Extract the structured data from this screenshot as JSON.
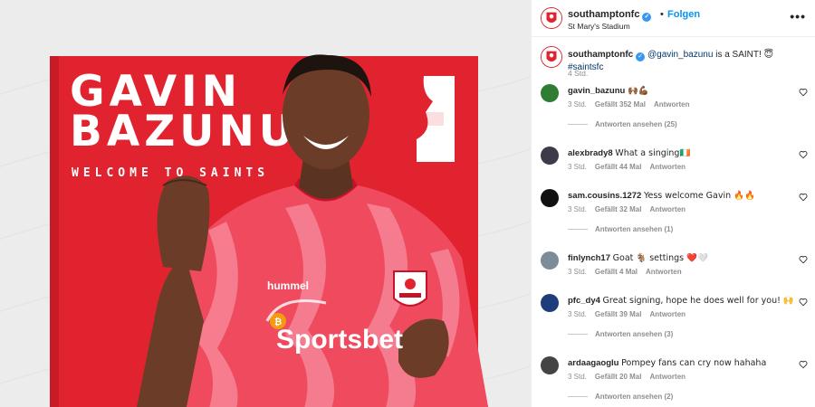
{
  "post": {
    "image": {
      "player_name_line1": "GAVIN",
      "player_name_line2": "BAZUNU",
      "tagline": "WELCOME TO SAINTS",
      "kit_brand": "hummel",
      "sponsor": "Sportsbet"
    }
  },
  "header": {
    "username": "southamptonfc",
    "verified": true,
    "separator": "•",
    "follow_label": "Folgen",
    "location": "St Mary's Stadium",
    "more_label": "•••"
  },
  "caption": {
    "username": "southamptonfc",
    "mention": "@gavin_bazunu",
    "text": " is a SAINT! ",
    "emoji": "😇",
    "hashtag": "#saintsfc",
    "time": "4 Std."
  },
  "comments": [
    {
      "username": "gavin_bazunu",
      "text": "🙌🏾💪🏾",
      "time": "3 Std.",
      "likes": "Gefällt 352 Mal",
      "reply": "Antworten",
      "view_replies": "Antworten ansehen (25)",
      "avatar_color": "#2e7d32"
    },
    {
      "username": "alexbrady8",
      "text": "What a singing🇮🇪",
      "time": "3 Std.",
      "likes": "Gefällt 44 Mal",
      "reply": "Antworten",
      "view_replies": "",
      "avatar_color": "#3d3a4a"
    },
    {
      "username": "sam.cousins.1272",
      "text": "Yess welcome Gavin 🔥🔥",
      "time": "3 Std.",
      "likes": "Gefällt 32 Mal",
      "reply": "Antworten",
      "view_replies": "Antworten ansehen (1)",
      "avatar_color": "#111111"
    },
    {
      "username": "finlynch17",
      "text": "Goat 🐐 settings ❤️🤍",
      "time": "3 Std.",
      "likes": "Gefällt 4 Mal",
      "reply": "Antworten",
      "view_replies": "",
      "avatar_color": "#7d8c99"
    },
    {
      "username": "pfc_dy4",
      "text": "Great signing, hope he does well for you! 🙌",
      "time": "3 Std.",
      "likes": "Gefällt 39 Mal",
      "reply": "Antworten",
      "view_replies": "Antworten ansehen (3)",
      "avatar_color": "#1e3d7b"
    },
    {
      "username": "ardaagaoglu",
      "text": "Pompey fans can cry now hahaha",
      "time": "3 Std.",
      "likes": "Gefällt 20 Mal",
      "reply": "Antworten",
      "view_replies": "Antworten ansehen (2)",
      "avatar_color": "#444444"
    }
  ],
  "colors": {
    "brand_red": "#e1232f",
    "link_blue": "#0095f6",
    "muted": "#8e8e8e",
    "verified_blue": "#3897f0"
  }
}
